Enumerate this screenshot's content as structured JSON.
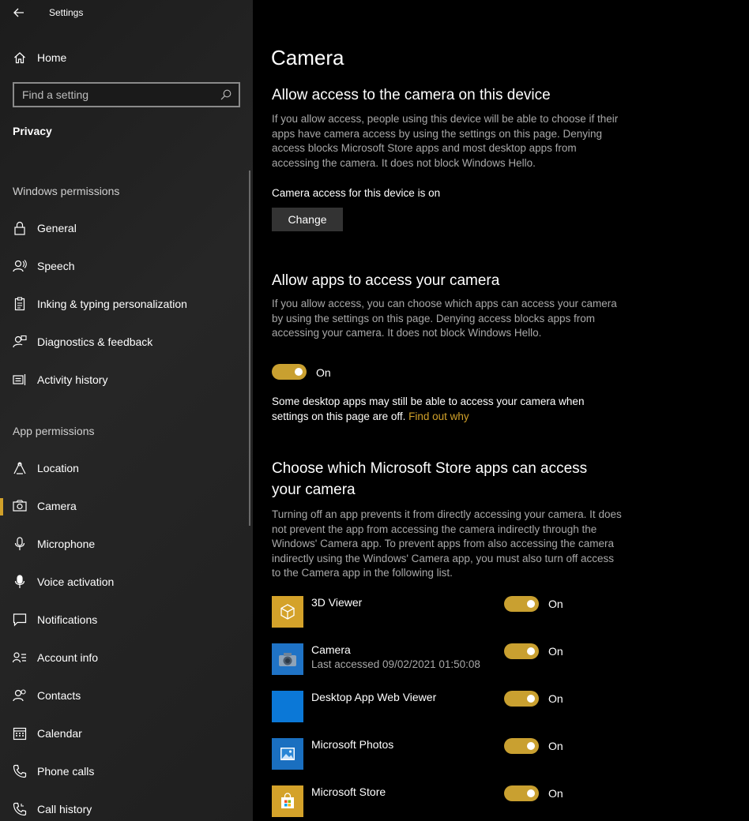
{
  "window": {
    "title": "Settings"
  },
  "sidebar": {
    "home_label": "Home",
    "search_placeholder": "Find a setting",
    "category": "Privacy",
    "windows_permissions_header": "Windows permissions",
    "app_permissions_header": "App permissions",
    "windows_items": [
      {
        "label": "General",
        "icon": "lock-icon"
      },
      {
        "label": "Speech",
        "icon": "speech-icon"
      },
      {
        "label": "Inking & typing personalization",
        "icon": "clipboard-icon"
      },
      {
        "label": "Diagnostics & feedback",
        "icon": "diagnostics-icon"
      },
      {
        "label": "Activity history",
        "icon": "activity-icon"
      }
    ],
    "app_items": [
      {
        "label": "Location",
        "icon": "location-icon"
      },
      {
        "label": "Camera",
        "icon": "camera-icon",
        "active": true
      },
      {
        "label": "Microphone",
        "icon": "microphone-icon"
      },
      {
        "label": "Voice activation",
        "icon": "voice-activation-icon"
      },
      {
        "label": "Notifications",
        "icon": "notifications-icon"
      },
      {
        "label": "Account info",
        "icon": "account-info-icon"
      },
      {
        "label": "Contacts",
        "icon": "contacts-icon"
      },
      {
        "label": "Calendar",
        "icon": "calendar-icon"
      },
      {
        "label": "Phone calls",
        "icon": "phone-icon"
      },
      {
        "label": "Call history",
        "icon": "call-history-icon"
      }
    ]
  },
  "main": {
    "title": "Camera",
    "device_section": {
      "heading": "Allow access to the camera on this device",
      "description": "If you allow access, people using this device will be able to choose if their apps have camera access by using the settings on this page. Denying access blocks Microsoft Store apps and most desktop apps from accessing the camera. It does not block Windows Hello.",
      "status": "Camera access for this device is on",
      "change_button": "Change"
    },
    "apps_section": {
      "heading": "Allow apps to access your camera",
      "description": "If you allow access, you can choose which apps can access your camera by using the settings on this page. Denying access blocks apps from accessing your camera. It does not block Windows Hello.",
      "toggle_label": "On",
      "toggle_on": true,
      "note": "Some desktop apps may still be able to access your camera when settings on this page are off.",
      "note_link": "Find out why"
    },
    "store_section": {
      "heading": "Choose which Microsoft Store apps can access your camera",
      "description": "Turning off an app prevents it from directly accessing your camera. It does not prevent the app from accessing the camera indirectly through the Windows' Camera app. To prevent apps from also accessing the camera indirectly using the Windows' Camera app, you must also turn off access to the Camera app in the following list.",
      "apps": [
        {
          "name": "3D Viewer",
          "subtitle": "",
          "toggle": "On",
          "icon": "cube-icon",
          "color": "#d4a22a"
        },
        {
          "name": "Camera",
          "subtitle": "Last accessed 09/02/2021 01:50:08",
          "toggle": "On",
          "icon": "camera-app-icon",
          "color": "#1f73c6"
        },
        {
          "name": "Desktop App Web Viewer",
          "subtitle": "",
          "toggle": "On",
          "icon": "web-viewer-icon",
          "color": "#0b78d7"
        },
        {
          "name": "Microsoft Photos",
          "subtitle": "",
          "toggle": "On",
          "icon": "photos-icon",
          "color": "#1a6fc0"
        },
        {
          "name": "Microsoft Store",
          "subtitle": "",
          "toggle": "On",
          "icon": "store-icon",
          "color": "#d4a22a"
        }
      ]
    }
  },
  "colors": {
    "accent": "#d1a12a",
    "toggle_on": "#c9a030",
    "sidebar_bg": "#222222",
    "main_bg": "#000000"
  }
}
